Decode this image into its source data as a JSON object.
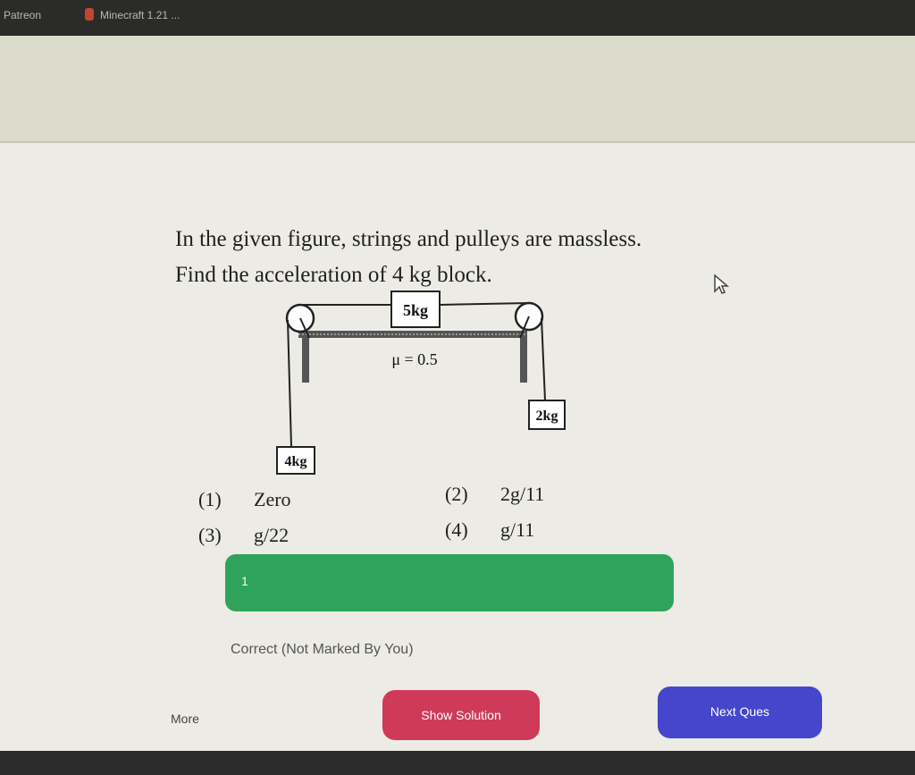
{
  "browser": {
    "tabs": [
      "Patreon",
      "Minecraft 1.21 ..."
    ]
  },
  "question": {
    "line1": "In the given figure, strings and pulleys are massless.",
    "line2": "Find the acceleration of 4 kg block."
  },
  "figure": {
    "block_top": "5kg",
    "block_left": "4kg",
    "block_right": "2kg",
    "friction": "μ = 0.5"
  },
  "options": [
    {
      "num": "(1)",
      "text": "Zero"
    },
    {
      "num": "(2)",
      "text": "2g/11"
    },
    {
      "num": "(3)",
      "text": "g/22"
    },
    {
      "num": "(4)",
      "text": "g/11"
    }
  ],
  "answer": {
    "value": "1",
    "status": "Correct (Not Marked By You)"
  },
  "footer": {
    "more": "More",
    "show_solution": "Show Solution",
    "next": "Next Ques"
  },
  "colors": {
    "answer_bar": "#2fa35a",
    "show_solution": "#d03a5a",
    "next": "#4646cc"
  }
}
